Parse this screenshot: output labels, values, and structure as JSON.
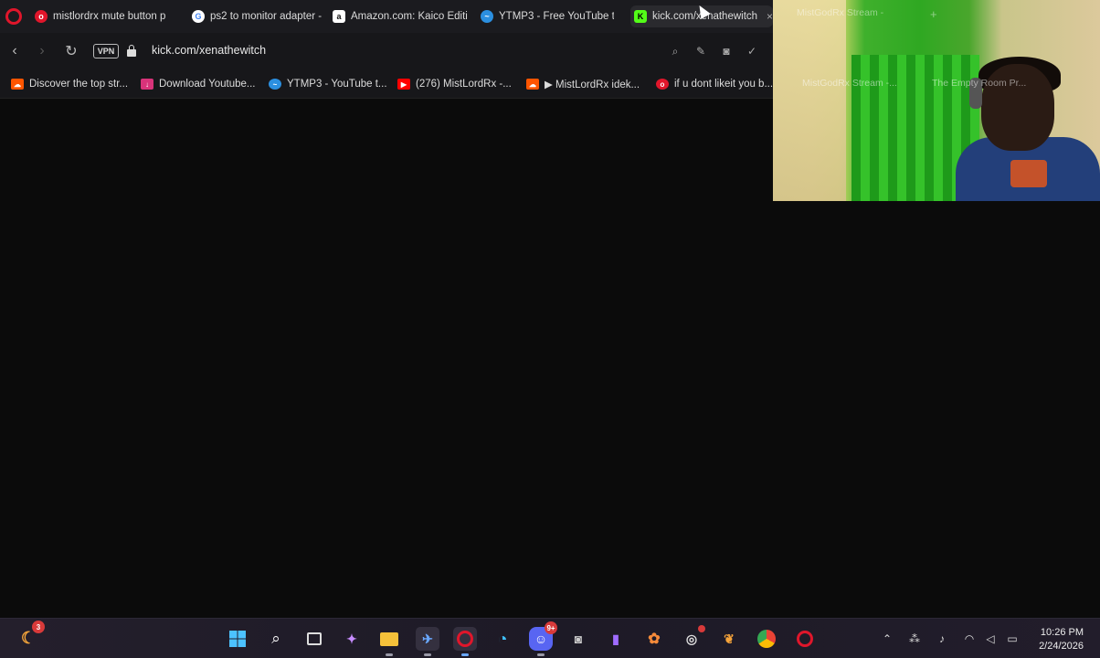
{
  "browser": {
    "tabs": [
      {
        "title": "mistlordrx mute button p",
        "favicon": "opera-red-icon",
        "color": "#e0162b",
        "active": false
      },
      {
        "title": "ps2 to monitor adapter -",
        "favicon": "google-icon",
        "color": "#4285f4",
        "active": false
      },
      {
        "title": "Amazon.com: Kaico Editio",
        "favicon": "amazon-icon",
        "color": "#ffffff",
        "active": false
      },
      {
        "title": "YTMP3 - Free YouTube to",
        "favicon": "ytmp3-icon",
        "color": "#2b8fe0",
        "active": false
      },
      {
        "title": "kick.com/xenathewitch",
        "favicon": "kick-icon",
        "color": "#53fc18",
        "active": true
      },
      {
        "title": "MistGodRx Stream -",
        "favicon": "kick-icon",
        "color": "#53fc18",
        "active": false
      }
    ],
    "new_tab_label": "+",
    "url": "kick.com/xenathewitch",
    "vpn_label": "VPN"
  },
  "bookmarks": [
    {
      "label": "Discover the top str...",
      "icon": "soundcloud-icon",
      "color": "#ff5500"
    },
    {
      "label": "Download Youtube...",
      "icon": "download-icon",
      "color": "#d8337a"
    },
    {
      "label": "YTMP3 - YouTube t...",
      "icon": "ytmp3-icon",
      "color": "#2b8fe0"
    },
    {
      "label": "(276) MistLordRx -...",
      "icon": "youtube-icon",
      "color": "#ff0000"
    },
    {
      "label": "▶ MistLordRx idek...",
      "icon": "soundcloud-icon",
      "color": "#ff5500"
    },
    {
      "label": "if u dont likeit you b...",
      "icon": "opera-icon",
      "color": "#e0162b"
    },
    {
      "label": "MistGodRx Stream -...",
      "icon": "kick-icon",
      "color": "#53fc18"
    },
    {
      "label": "The Empty Room Pr...",
      "icon": "globe-icon",
      "color": "#88a"
    }
  ],
  "taskbar": {
    "weather_badge": "3",
    "discord_badge": "9+",
    "time": "10:26 PM",
    "date": "2/24/2026"
  }
}
